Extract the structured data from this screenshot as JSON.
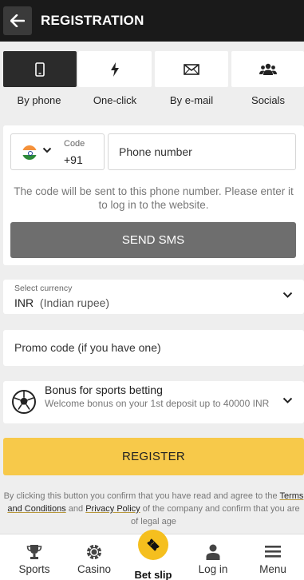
{
  "header": {
    "title": "REGISTRATION"
  },
  "tabs": [
    {
      "label": "By phone",
      "icon": "phone-icon",
      "active": true
    },
    {
      "label": "One-click",
      "icon": "lightning-icon",
      "active": false
    },
    {
      "label": "By e-mail",
      "icon": "envelope-icon",
      "active": false
    },
    {
      "label": "Socials",
      "icon": "people-icon",
      "active": false
    }
  ],
  "phone": {
    "country_icon": "india-flag-icon",
    "code_label": "Code",
    "code_value": "+91",
    "input_placeholder": "Phone number",
    "hint": "The code will be sent to this phone number. Please enter it to log in to the website.",
    "send_button": "SEND SMS"
  },
  "currency": {
    "label": "Select currency",
    "code": "INR",
    "name": "(Indian rupee)"
  },
  "promo": {
    "placeholder": "Promo code (if you have one)"
  },
  "bonus": {
    "title": "Bonus for sports betting",
    "description": "Welcome bonus on your 1st deposit up to 40000 INR"
  },
  "register_button": "REGISTER",
  "legal": {
    "prefix": "By clicking this button you confirm that you have read and agree to the",
    "terms_link": "Terms and Conditions",
    "and": "and",
    "privacy_link": "Privacy Policy",
    "suffix": "of the company and confirm that you are of legal age"
  },
  "bottom_nav": [
    {
      "label": "Sports",
      "icon": "trophy-icon"
    },
    {
      "label": "Casino",
      "icon": "poker-chip-icon"
    },
    {
      "label": "Bet slip",
      "icon": "ticket-icon"
    },
    {
      "label": "Log in",
      "icon": "user-icon"
    },
    {
      "label": "Menu",
      "icon": "hamburger-icon"
    }
  ],
  "colors": {
    "header_bg": "#1a1a1a",
    "accent_yellow": "#f7c94a",
    "sms_button": "#6e6e6e"
  }
}
